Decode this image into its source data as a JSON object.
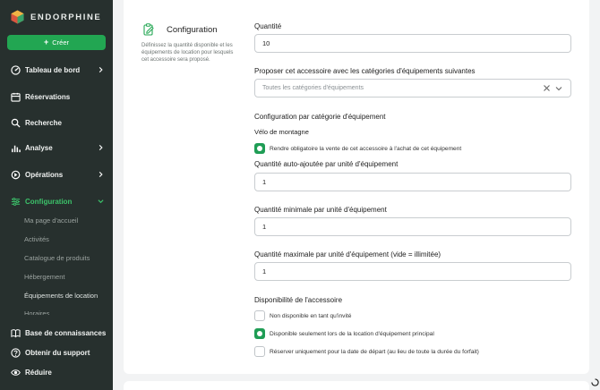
{
  "sidebar": {
    "brand": "ENDORPHINE",
    "create_label": "Créer",
    "items": [
      {
        "label": "Tableau de bord",
        "icon": "dashboard-icon"
      },
      {
        "label": "Réservations",
        "icon": "calendar-icon"
      },
      {
        "label": "Recherche",
        "icon": "search-icon"
      },
      {
        "label": "Analyse",
        "icon": "bar-chart-icon"
      },
      {
        "label": "Opérations",
        "icon": "operations-icon"
      },
      {
        "label": "Configuration",
        "icon": "sliders-icon"
      }
    ],
    "sub_items": [
      "Ma page d'accueil",
      "Activités",
      "Catalogue de produits",
      "Hébergement",
      "Équipements de location",
      "Horaires"
    ],
    "bottom": [
      {
        "label": "Base de connaissances",
        "icon": "book-icon"
      },
      {
        "label": "Obtenir du support",
        "icon": "help-icon"
      },
      {
        "label": "Réduire",
        "icon": "eye-icon"
      }
    ]
  },
  "section": {
    "title": "Configuration",
    "description": "Définissez la quantité disponible et les équipements de location pour lesquels cet accessoire sera proposé."
  },
  "form": {
    "quantity_label": "Quantité",
    "quantity_value": "10",
    "categories_label": "Proposer cet accessoire avec les catégories d'équipements suivantes",
    "categories_placeholder": "Toutes les catégories d'équipements",
    "per_category_heading": "Configuration par catégorie d'équipement",
    "category_name": "Vélo de montagne",
    "mandatory_label": "Rendre obligatoire la vente de cet accessoire à l'achat de cet équipement",
    "mandatory_checked": true,
    "auto_label": "Quantité auto-ajoutée par unité d'équipement",
    "auto_value": "1",
    "min_label": "Quantité minimale par unité d'équipement",
    "min_value": "1",
    "max_label": "Quantité maximale par unité d'équipement (vide = illimitée)",
    "max_value": "1",
    "availability_heading": "Disponibilité de l'accessoire",
    "availability_options": [
      {
        "label": "Non disponible en tant qu'invité",
        "checked": false
      },
      {
        "label": "Disponible seulement lors de la location d'équipement principal",
        "checked": true
      },
      {
        "label": "Réserver uniquement pour la date de départ (au lieu de toute la durée du forfait)",
        "checked": false
      }
    ]
  },
  "colors": {
    "sidebar_bg": "#27302e",
    "accent_green": "#22a652",
    "active_green": "#3cc26a"
  }
}
